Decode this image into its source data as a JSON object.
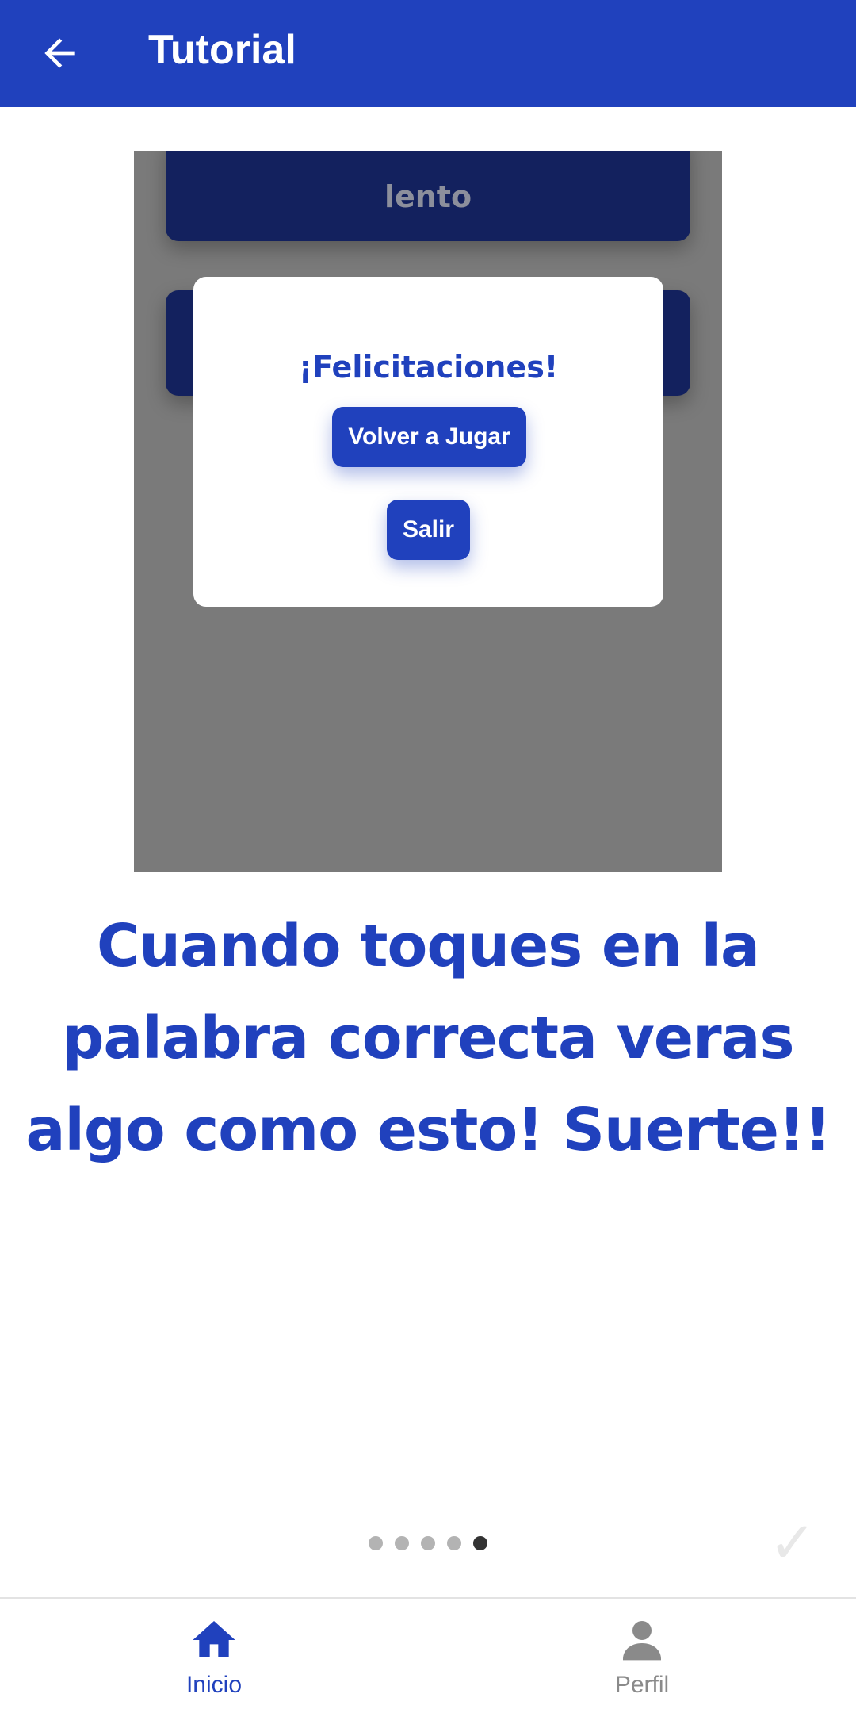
{
  "appbar": {
    "title": "Tutorial",
    "back_icon": "arrow-left-icon"
  },
  "tutorial_image": {
    "bg_button_label": "lento",
    "dialog": {
      "title": "¡Felicitaciones!",
      "play_again_label": "Volver a Jugar",
      "exit_label": "Salir"
    }
  },
  "tutorial_text": "Cuando toques en la palabra correcta veras algo como esto! Suerte!!",
  "pager": {
    "total": 5,
    "active_index": 4,
    "done_icon": "checkmark-icon",
    "done_glyph": "✓"
  },
  "bottom_nav": {
    "items": [
      {
        "label": "Inicio",
        "icon": "home-icon",
        "active": true
      },
      {
        "label": "Perfil",
        "icon": "person-icon",
        "active": false
      }
    ]
  },
  "colors": {
    "primary": "#2041bd",
    "dim_overlay": "#7a7a7a",
    "dark_button": "#13215e",
    "inactive_grey": "#8a8a8a"
  }
}
